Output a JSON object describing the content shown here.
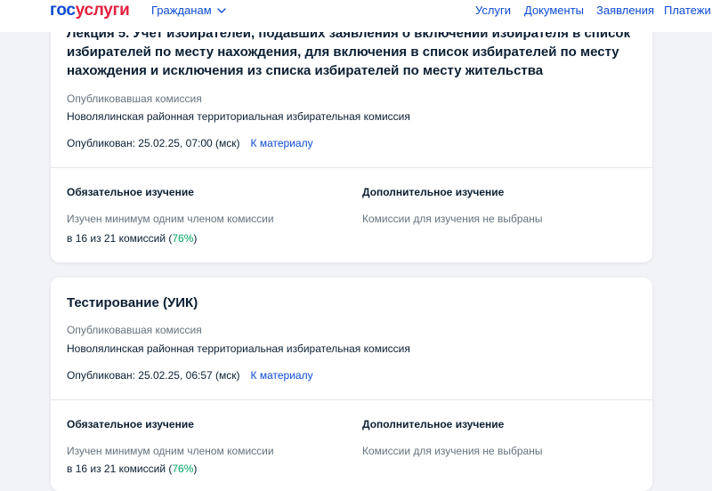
{
  "header": {
    "logo_part1": "гос",
    "logo_part2": "услуги",
    "audience": "Гражданам",
    "nav": [
      "Услуги",
      "Документы",
      "Заявления",
      "Платежи"
    ]
  },
  "cards": [
    {
      "title": "Лекция 5. Учет избирателей, подавших заявления о включении избирателя в список избирателей по месту нахождения, для включения в список избирателей по месту нахождения и исключения из списка избирателей по месту жительства",
      "publisher_label": "Опубликовавшая комиссия",
      "publisher": "Новолялинская районная территориальная избирательная комиссия",
      "published": "Опубликован: 25.02.25, 07:00 (мск)",
      "link": "К материалу",
      "mandatory_title": "Обязательное изучение",
      "mandatory_desc": "Изучен минимум одним членом комиссии",
      "mandatory_stat": "в 16 из 21 комиссий (",
      "mandatory_pct": "76%",
      "mandatory_close": ")",
      "optional_title": "Дополнительное изучение",
      "optional_desc": "Комиссии для изучения не выбраны"
    },
    {
      "title": "Тестирование (УИК)",
      "publisher_label": "Опубликовавшая комиссия",
      "publisher": "Новолялинская районная территориальная избирательная комиссия",
      "published": "Опубликован: 25.02.25, 06:57 (мск)",
      "link": "К материалу",
      "mandatory_title": "Обязательное изучение",
      "mandatory_desc": "Изучен минимум одним членом комиссии",
      "mandatory_stat": "в 16 из 21 комиссий (",
      "mandatory_pct": "76%",
      "mandatory_close": ")",
      "optional_title": "Дополнительное изучение",
      "optional_desc": "Комиссии для изучения не выбраны"
    }
  ],
  "colors": {
    "brand_blue": "#0d4cd3",
    "brand_red": "#e3223f",
    "percent_green": "#00a560"
  }
}
